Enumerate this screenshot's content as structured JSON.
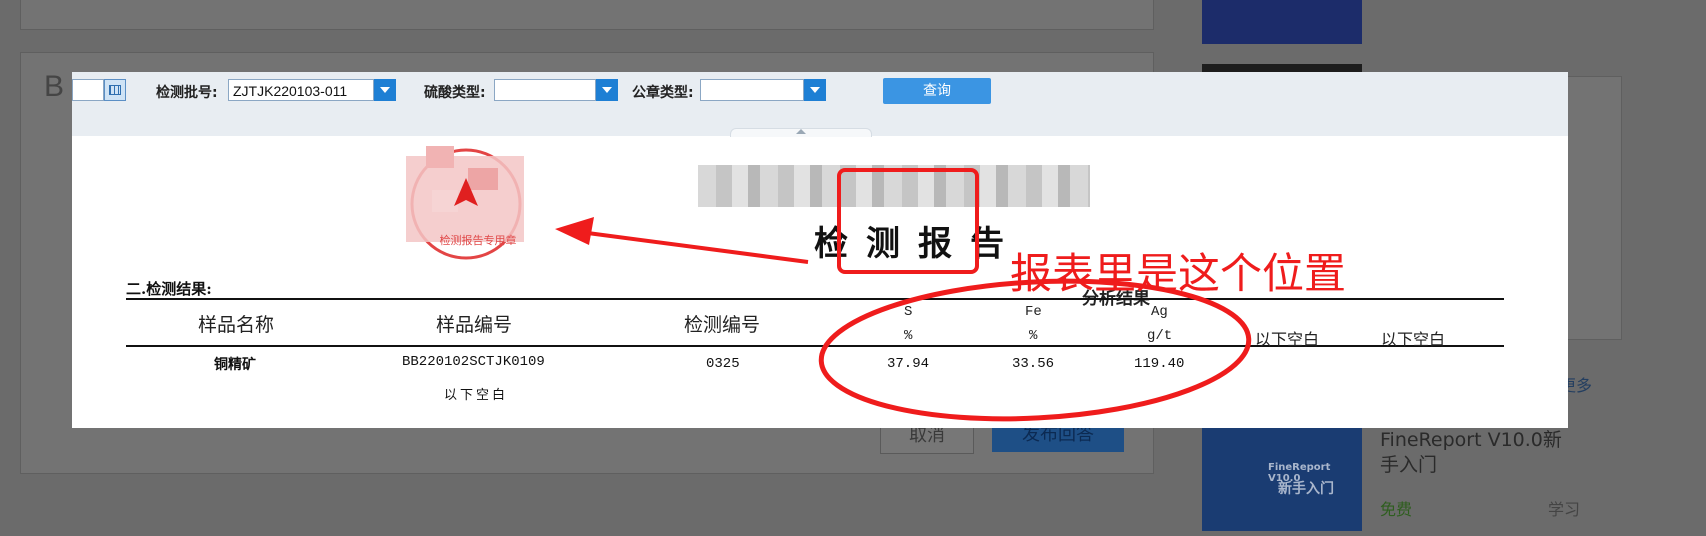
{
  "background": {
    "letter": "B",
    "cancel_label": "取消",
    "publish_label": "发布回答",
    "side_more": "更多",
    "course": {
      "cover_line1": "FineReport V10.0",
      "cover_line2": "新手入门",
      "title": "FineReport V10.0新手入门",
      "price": "免费",
      "action": "学习"
    }
  },
  "toolbar": {
    "batch_label": "检测批号:",
    "batch_value": "ZJTJK220103-011",
    "acid_label": "硫酸类型:",
    "acid_value": "",
    "seal_type_label": "公章类型:",
    "seal_type_value": "",
    "query_label": "查询"
  },
  "report": {
    "title": "检测报告",
    "seal_text": "检测报告专用章",
    "section_title": "二.检测结果:",
    "group_header": "分析结果",
    "headers": {
      "sample_name": "样品名称",
      "sample_no": "样品编号",
      "test_no": "检测编号",
      "s": "S",
      "s_unit": "%",
      "fe": "Fe",
      "fe_unit": "%",
      "ag": "Ag",
      "ag_unit": "g/t",
      "blank1": "以下空白",
      "blank2": "以下空白"
    },
    "rows": [
      {
        "sample_name": "铜精矿",
        "sample_no": "BB220102SCTJK0109",
        "test_no": "0325",
        "s": "37.94",
        "fe": "33.56",
        "ag": "119.40"
      }
    ],
    "blank_note": "以下空白"
  },
  "annotation": {
    "text": "报表里是这个位置",
    "color": "#ef1c1c"
  }
}
